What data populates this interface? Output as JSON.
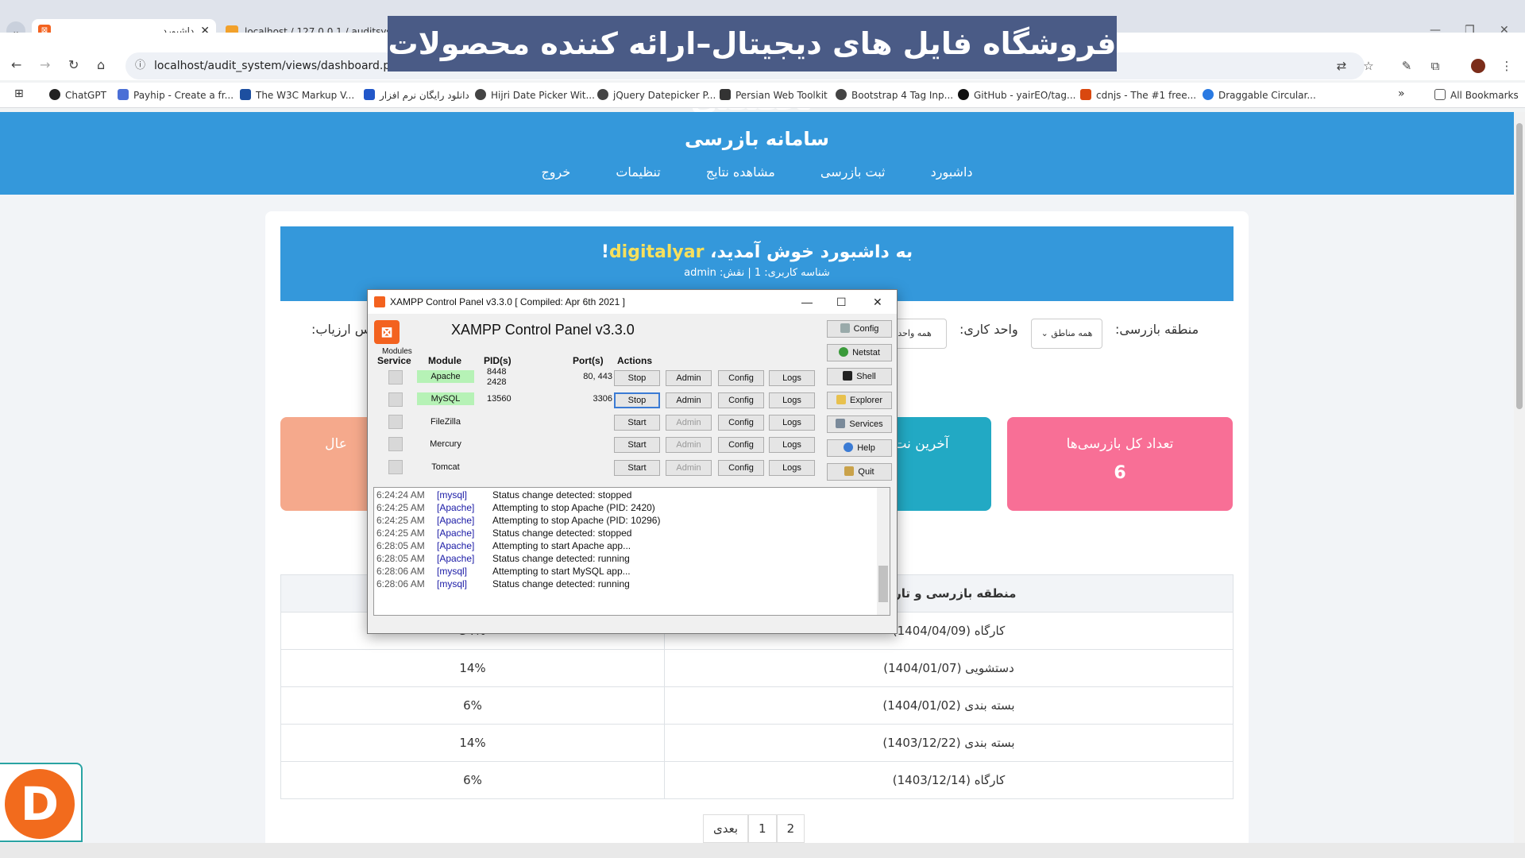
{
  "browser": {
    "active_tab_title": "داشبورد",
    "inactive_tab_title": "localhost / 127.0.0.1 / auditsyst",
    "url": "localhost/audit_system/views/dashboard.php",
    "bookmarks": [
      {
        "label": "ChatGPT",
        "color": "#222222"
      },
      {
        "label": "Payhip - Create a fr...",
        "color": "#4b6fd6"
      },
      {
        "label": "The W3C Markup V...",
        "color": "#1d4fa0"
      },
      {
        "label": "دانلود رایگان نرم افزار",
        "color": "#2257c9"
      },
      {
        "label": "Hijri Date Picker Wit...",
        "color": "#444444"
      },
      {
        "label": "jQuery Datepicker P...",
        "color": "#444444"
      },
      {
        "label": "Persian Web Toolkit",
        "color": "#333333"
      },
      {
        "label": "Bootstrap 4 Tag Inp...",
        "color": "#444444"
      },
      {
        "label": "GitHub - yairEO/tag...",
        "color": "#111111"
      },
      {
        "label": "cdnjs - The #1 free...",
        "color": "#d9480f"
      },
      {
        "label": "Draggable Circular...",
        "color": "#2a7ae2"
      }
    ],
    "all_bookmarks_label": "All Bookmarks"
  },
  "banner": {
    "text": "فروشگاه فایل های دیجیتال–ارائه کننده محصولات تخصصی"
  },
  "site": {
    "title": "سامانه بازرسی",
    "nav": [
      "داشبورد",
      "ثبت بازرسی",
      "مشاهده نتایج",
      "تنظیمات",
      "خروج"
    ],
    "welcome_prefix": "به داشبورد خوش آمدید، ",
    "welcome_user": "digitalyar",
    "welcome_suffix": "!",
    "user_info": "شناسه کاربری: 1 | نقش: admin",
    "filters": {
      "region_label": "منطقه بازرسی:",
      "region_value": "همه مناطق",
      "unit_label": "واحد کاری:",
      "unit_value": "همه واحدها",
      "assessor_label": "س ارزیاب:"
    },
    "stats": [
      {
        "title": "تعداد کل بازرسی‌ها",
        "value": "6",
        "color": "#f86f96"
      },
      {
        "title": "آخرین نت",
        "value": "",
        "color": "#22a9c4"
      },
      {
        "title": "عال",
        "value": "",
        "color": "#f5a98c"
      }
    ],
    "table": {
      "headers": [
        "منطقه بازرسی و تاریخ",
        ""
      ],
      "rows": [
        [
          "کارگاه (1404/04/09)",
          "34%"
        ],
        [
          "دستشویی (1404/01/07)",
          "14%"
        ],
        [
          "بسته بندی (1404/01/02)",
          "6%"
        ],
        [
          "بسته بندی (1403/12/22)",
          "14%"
        ],
        [
          "کارگاه (1403/12/14)",
          "6%"
        ]
      ]
    },
    "pager": {
      "next": "بعدی",
      "pages": [
        "1",
        "2"
      ]
    }
  },
  "logo_letter": "D",
  "xampp": {
    "window_title": "XAMPP Control Panel v3.3.0   [ Compiled: Apr 6th 2021 ]",
    "heading": "XAMPP Control Panel v3.3.0",
    "modules_label": "Modules",
    "headers": {
      "service": "Service",
      "module": "Module",
      "pid": "PID(s)",
      "port": "Port(s)",
      "actions": "Actions"
    },
    "modules": [
      {
        "name": "Apache",
        "pid1": "8448",
        "pid2": "2428",
        "port": "80, 443",
        "action": "Stop",
        "admin": "Admin",
        "config": "Config",
        "logs": "Logs"
      },
      {
        "name": "MySQL",
        "pid1": "13560",
        "pid2": "",
        "port": "3306",
        "action": "Stop",
        "admin": "Admin",
        "config": "Config",
        "logs": "Logs"
      },
      {
        "name": "FileZilla",
        "pid1": "",
        "pid2": "",
        "port": "",
        "action": "Start",
        "admin": "Admin",
        "config": "Config",
        "logs": "Logs"
      },
      {
        "name": "Mercury",
        "pid1": "",
        "pid2": "",
        "port": "",
        "action": "Start",
        "admin": "Admin",
        "config": "Config",
        "logs": "Logs"
      },
      {
        "name": "Tomcat",
        "pid1": "",
        "pid2": "",
        "port": "",
        "action": "Start",
        "admin": "Admin",
        "config": "Config",
        "logs": "Logs"
      }
    ],
    "side_buttons": [
      "Config",
      "Netstat",
      "Shell",
      "Explorer",
      "Services",
      "Help",
      "Quit"
    ],
    "log": [
      {
        "time": "6:24:24 AM",
        "module": "[mysql]",
        "text": "Status change detected: stopped"
      },
      {
        "time": "6:24:25 AM",
        "module": "[Apache]",
        "text": "Attempting to stop Apache (PID: 2420)"
      },
      {
        "time": "6:24:25 AM",
        "module": "[Apache]",
        "text": "Attempting to stop Apache (PID: 10296)"
      },
      {
        "time": "6:24:25 AM",
        "module": "[Apache]",
        "text": "Status change detected: stopped"
      },
      {
        "time": "6:28:05 AM",
        "module": "[Apache]",
        "text": "Attempting to start Apache app..."
      },
      {
        "time": "6:28:05 AM",
        "module": "[Apache]",
        "text": "Status change detected: running"
      },
      {
        "time": "6:28:06 AM",
        "module": "[mysql]",
        "text": "Attempting to start MySQL app..."
      },
      {
        "time": "6:28:06 AM",
        "module": "[mysql]",
        "text": "Status change detected: running"
      }
    ]
  }
}
